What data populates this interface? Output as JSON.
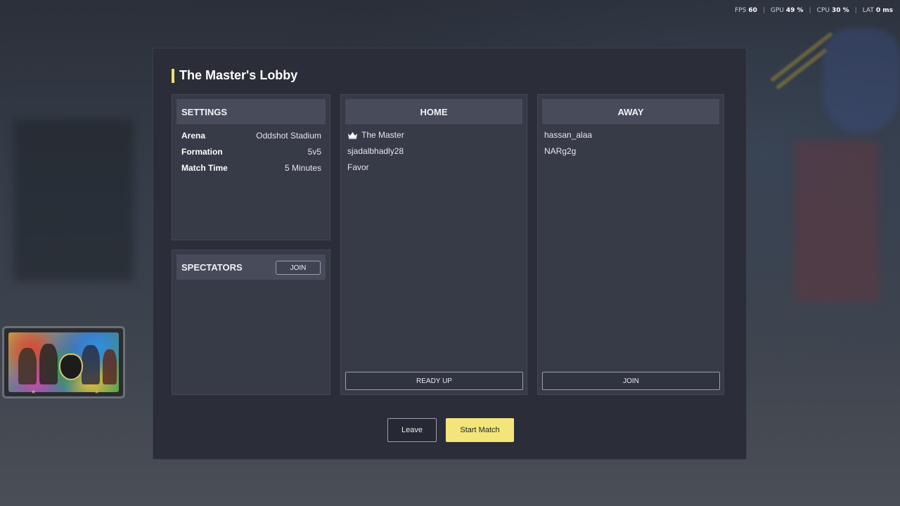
{
  "stats": {
    "fps_label": "FPS",
    "fps_value": "60",
    "gpu_label": "GPU",
    "gpu_value": "49 %",
    "cpu_label": "CPU",
    "cpu_value": "30 %",
    "lat_label": "LAT",
    "lat_value": "0 ms",
    "separator": "|"
  },
  "lobby": {
    "title": "The Master's Lobby",
    "accent_color": "#f3e06e"
  },
  "settings": {
    "header": "SETTINGS",
    "rows": [
      {
        "key": "Arena",
        "value": "Oddshot Stadium"
      },
      {
        "key": "Formation",
        "value": "5v5"
      },
      {
        "key": "Match Time",
        "value": "5 Minutes"
      }
    ]
  },
  "spectators": {
    "header": "SPECTATORS",
    "join_label": "JOIN"
  },
  "home": {
    "header": "HOME",
    "players": [
      "The Master",
      "sjadalbhadly28",
      "Favor"
    ],
    "host_icon": "crown-icon",
    "ready_label": "READY UP"
  },
  "away": {
    "header": "AWAY",
    "players": [
      "hassan_alaa",
      "NARg2g"
    ],
    "join_label": "JOIN"
  },
  "actions": {
    "leave_label": "Leave",
    "start_label": "Start Match",
    "start_color": "#f3e57a"
  }
}
